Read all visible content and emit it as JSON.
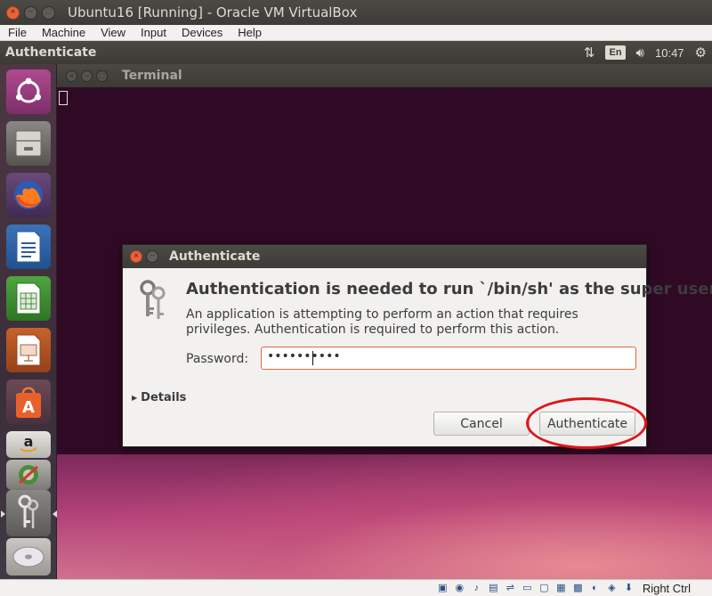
{
  "host_window": {
    "title": "Ubuntu16 [Running] - Oracle VM VirtualBox",
    "menu": [
      "File",
      "Machine",
      "View",
      "Input",
      "Devices",
      "Help"
    ]
  },
  "top_panel": {
    "app_title": "Authenticate",
    "keyboard_layout": "En",
    "clock": "10:47"
  },
  "launcher": {
    "items": [
      {
        "name": "dash-home-icon"
      },
      {
        "name": "files-icon"
      },
      {
        "name": "firefox-icon"
      },
      {
        "name": "libreoffice-writer-icon"
      },
      {
        "name": "libreoffice-calc-icon"
      },
      {
        "name": "libreoffice-impress-icon"
      },
      {
        "name": "ubuntu-software-icon"
      },
      {
        "name": "amazon-icon"
      },
      {
        "name": "system-settings-icon"
      },
      {
        "name": "keys-icon"
      },
      {
        "name": "dvd-icon"
      }
    ]
  },
  "terminal": {
    "title": "Terminal"
  },
  "dialog": {
    "title": "Authenticate",
    "heading": "Authentication is needed to run `/bin/sh' as the super user",
    "description": "An application is attempting to perform an action that requires privileges. Authentication is required to perform this action.",
    "password_label": "Password:",
    "password_value": "••••••••••",
    "details_label": "Details",
    "cancel_label": "Cancel",
    "authenticate_label": "Authenticate"
  },
  "statusbar": {
    "host_key": "Right Ctrl"
  }
}
